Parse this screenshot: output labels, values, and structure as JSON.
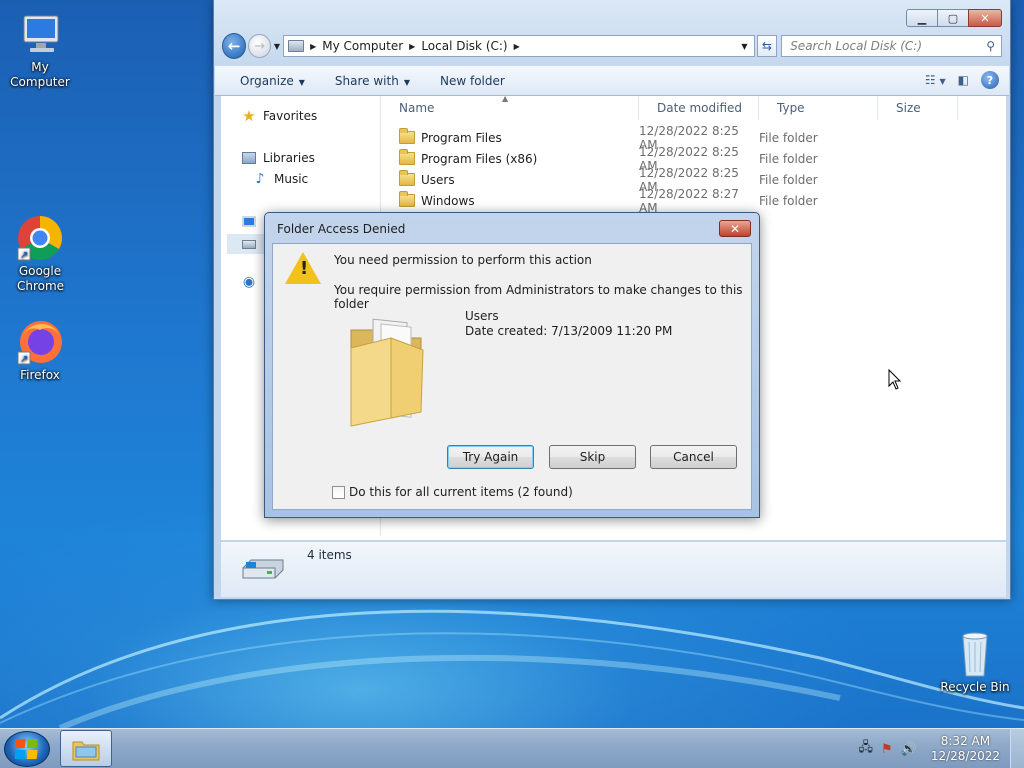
{
  "desktop": {
    "icons": [
      {
        "name": "my-computer",
        "label": "My Computer"
      },
      {
        "name": "google-chrome",
        "label": "Google Chrome"
      },
      {
        "name": "firefox",
        "label": "Firefox"
      },
      {
        "name": "recycle-bin",
        "label": "Recycle Bin"
      }
    ]
  },
  "explorer": {
    "address": {
      "crumbs": [
        "My Computer",
        "Local Disk (C:)"
      ]
    },
    "search_placeholder": "Search Local Disk (C:)",
    "toolbar": {
      "organize": "Organize",
      "share_with": "Share with",
      "new_folder": "New folder"
    },
    "nav": {
      "favorites": "Favorites",
      "libraries": "Libraries",
      "music": "Music"
    },
    "columns": {
      "name": "Name",
      "date_modified": "Date modified",
      "type": "Type",
      "size": "Size"
    },
    "files": [
      {
        "name": "Program Files",
        "date": "12/28/2022 8:25 AM",
        "type": "File folder"
      },
      {
        "name": "Program Files (x86)",
        "date": "12/28/2022 8:25 AM",
        "type": "File folder"
      },
      {
        "name": "Users",
        "date": "12/28/2022 8:25 AM",
        "type": "File folder"
      },
      {
        "name": "Windows",
        "date": "12/28/2022 8:27 AM",
        "type": "File folder"
      }
    ],
    "status": "4 items"
  },
  "dialog": {
    "title": "Folder Access Denied",
    "message_main": "You need permission to perform this action",
    "message_detail": "You require permission from Administrators to make changes to this folder",
    "item_name": "Users",
    "item_date": "Date created: 7/13/2009 11:20 PM",
    "buttons": {
      "try_again": "Try Again",
      "skip": "Skip",
      "cancel": "Cancel"
    },
    "checkbox_label": "Do this for all current items (2 found)",
    "checkbox_checked": false
  },
  "taskbar": {
    "time": "8:32 AM",
    "date": "12/28/2022"
  },
  "colors": {
    "accent": "#1f78cf",
    "warning": "#f2c21b",
    "close": "#c2412a"
  }
}
